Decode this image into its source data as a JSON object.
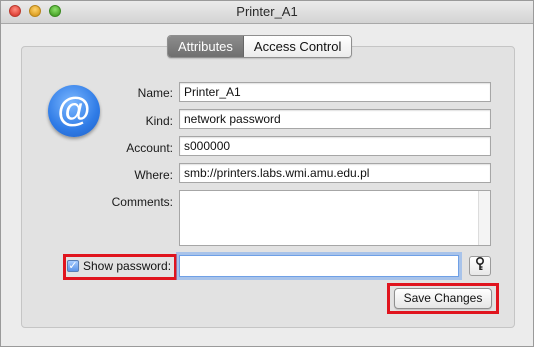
{
  "window": {
    "title": "Printer_A1"
  },
  "tabs": [
    {
      "label": "Attributes",
      "active": true
    },
    {
      "label": "Access Control",
      "active": false
    }
  ],
  "icon": {
    "name": "at-sign-icon",
    "glyph": "@"
  },
  "form": {
    "name_label": "Name:",
    "name_value": "Printer_A1",
    "kind_label": "Kind:",
    "kind_value": "network password",
    "account_label": "Account:",
    "account_value": "s000000",
    "where_label": "Where:",
    "where_value": "smb://printers.labs.wmi.amu.edu.pl",
    "comments_label": "Comments:",
    "comments_value": ""
  },
  "password": {
    "show_label": "Show password:",
    "checked": true,
    "value": "",
    "key_icon": "key-icon"
  },
  "actions": {
    "save_label": "Save Changes"
  },
  "colors": {
    "highlight": "#e0141e",
    "accent": "#2f7be6"
  }
}
